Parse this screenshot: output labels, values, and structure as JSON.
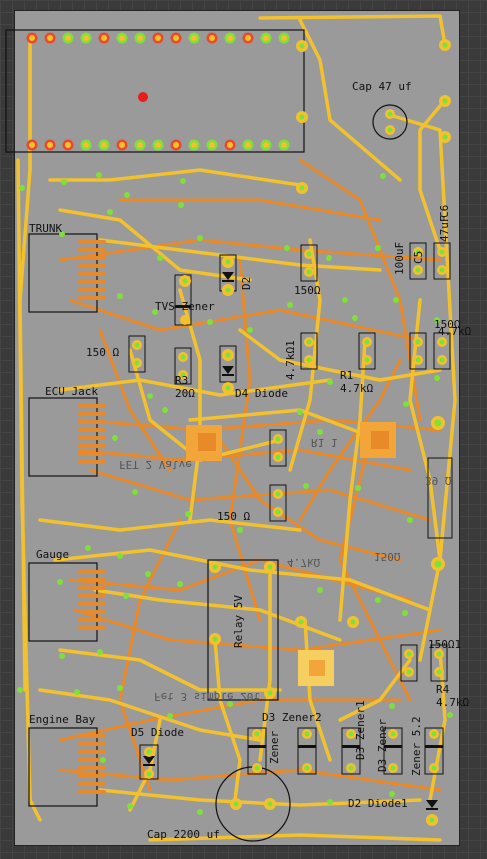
{
  "board_title": "",
  "corner_mark": "",
  "labels": {
    "cap47": "Cap 47 uf",
    "cap2200": "Cap 2200 uf",
    "c6": "C6",
    "c6_val": "47uF",
    "c5": "C5",
    "c5_val": "100uF",
    "trunk": "TRUNK",
    "ecu": "ECU Jack",
    "gauge": "Gauge",
    "engine": "Engine Bay",
    "tvs": "TVS Zener",
    "d2": "D2",
    "r150_a": "150Ω",
    "r150_b": "150 Ω",
    "r150_c": "150 Ω",
    "r150_d": "150Ω",
    "r150_e": "150Ω1",
    "r3": "R3",
    "r3_val": "20Ω",
    "d4": "D4 Diode",
    "r47_v": "4.7kΩ1",
    "r1": "R1",
    "r1_val": "4.7kΩ",
    "r4_val2": "4.7kΩ",
    "r4": "R4",
    "r4_val": "4.7kΩ",
    "relay": "Relay 5V",
    "d5": "D5 Diode",
    "d3": "D3 Zener2",
    "d3b": "D3 Zener1",
    "d3c": "D3 Zener",
    "zener": "Zener",
    "zener5": "Zener 5.2",
    "d2diode": "D2 Diode1",
    "mirror_valve": "FET 2 Valve",
    "mirror_simple": "Fet 3 simple 20t",
    "mirror_r": "R1 1",
    "mirror_r47": "4.7kΩ",
    "mirror_150": "150Ω",
    "mirror_39": "39 Ω"
  },
  "colors": {
    "board": "#9a9a9a",
    "trace_yellow": "#f2c12e",
    "trace_orange": "#e8892a",
    "pad_green": "#7fe03a",
    "pad_red": "#e84a2a",
    "silk": "#111111"
  }
}
